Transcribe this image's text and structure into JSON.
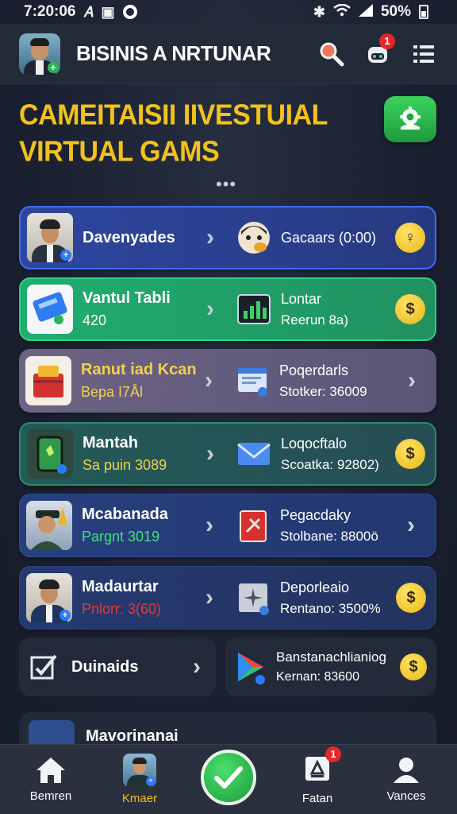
{
  "status_bar": {
    "time": "7:20:06",
    "battery": "50%"
  },
  "header": {
    "title": "BISINIS A NRTUNAR",
    "notification_count": "1"
  },
  "hero": {
    "title_line1": "CAMEITAISII IIVESTUIAL",
    "title_line2": "VIRTUAL GAMS",
    "dots": "•••"
  },
  "cards": [
    {
      "title": "Davenyades",
      "subtitle": "",
      "right_title": "Gacaars (0:00)",
      "right_subtitle": "",
      "end": "coin"
    },
    {
      "title": "Vantul Tabli",
      "subtitle": "420",
      "right_title": "Lontar",
      "right_subtitle": "Reerun 8a)",
      "end": "coin"
    },
    {
      "title": "Ranut iad Kcan",
      "subtitle": "Bepa I7Ål",
      "right_title": "Poqerdarls",
      "right_subtitle": "Stotker: 36009",
      "end": "chevron"
    },
    {
      "title": "Mantah",
      "subtitle": "Sa puin 3089",
      "right_title": "Loqocftalo",
      "right_subtitle": "Scoatka: 92802)",
      "end": "coin"
    },
    {
      "title": "Mcabanada",
      "subtitle": "Pargnt 3019",
      "right_title": "Pegacdaky",
      "right_subtitle": "Stolbane: 8800ö",
      "end": "chevron"
    },
    {
      "title": "Madaurtar",
      "subtitle": "Pnlorr: 3(60)",
      "right_title": "Deporleaio",
      "right_subtitle": "Rentano: 3500%",
      "end": "coin"
    }
  ],
  "half_cards": {
    "left_label": "Duinaids",
    "right_title": "Banstanachlianiog",
    "right_subtitle": "Kernan: 83600"
  },
  "partial_card": {
    "title": "Mavorinanai"
  },
  "bottom_nav": [
    {
      "label": "Bemren"
    },
    {
      "label": "Kmaer"
    },
    {
      "label": ""
    },
    {
      "label": "Fatan",
      "badge": "1"
    },
    {
      "label": "Vances"
    }
  ],
  "colors": {
    "accent_yellow": "#f2c21b",
    "accent_green": "#2bb55a",
    "badge_red": "#e4252b",
    "card_blue": "#2d46a0",
    "card_green": "#1fae6f"
  }
}
